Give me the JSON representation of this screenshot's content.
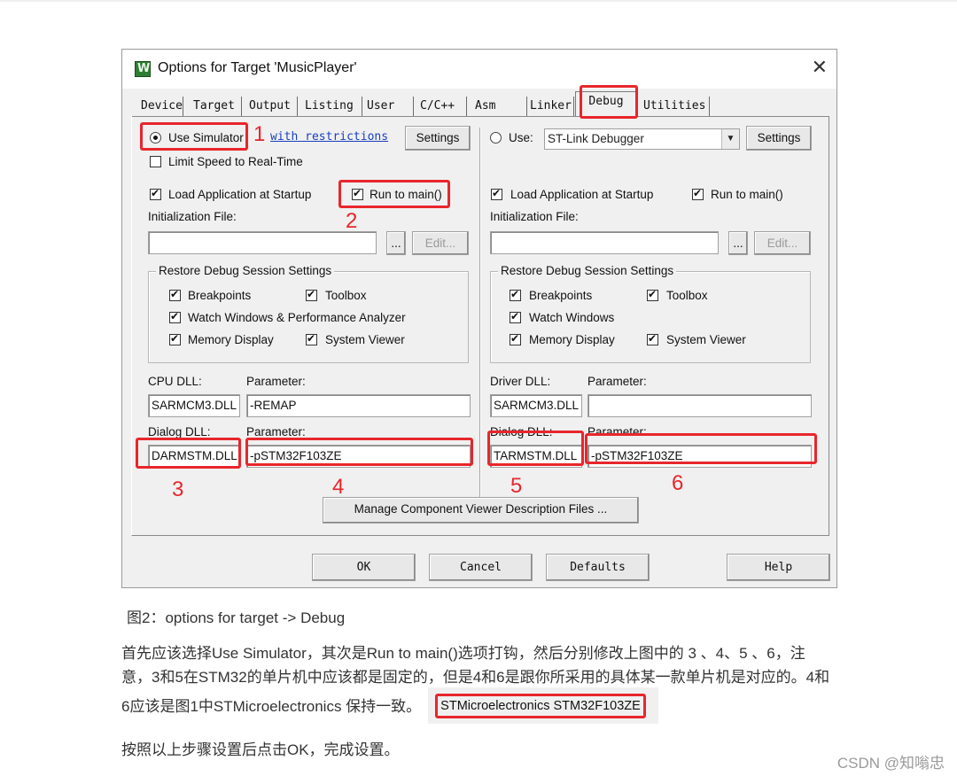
{
  "dialog": {
    "title": "Options for Target 'MusicPlayer'",
    "close_icon": "close-icon",
    "tabs": [
      "Device",
      "Target",
      "Output",
      "Listing",
      "User",
      "C/C++",
      "Asm",
      "Linker",
      "Debug",
      "Utilities"
    ],
    "active_tab": "Debug",
    "left": {
      "use_simulator": "Use Simulator",
      "with_restrictions": "with restrictions",
      "settings": "Settings",
      "limit_speed": "Limit Speed to Real-Time",
      "load_app": "Load Application at Startup",
      "run_to_main": "Run to main()",
      "init_file_label": "Initialization File:",
      "browse": "...",
      "edit": "Edit...",
      "restore_title": "Restore Debug Session Settings",
      "breakpoints": "Breakpoints",
      "toolbox": "Toolbox",
      "watch_windows": "Watch Windows & Performance Analyzer",
      "memory_display": "Memory Display",
      "system_viewer": "System Viewer",
      "cpu_dll_label": "CPU DLL:",
      "cpu_param_label": "Parameter:",
      "cpu_dll_value": "SARMCM3.DLL",
      "cpu_param_value": "-REMAP",
      "dialog_dll_label": "Dialog DLL:",
      "dialog_param_label": "Parameter:",
      "dialog_dll_value": "DARMSTM.DLL",
      "dialog_param_value": "-pSTM32F103ZE"
    },
    "right": {
      "use": "Use:",
      "debugger": "ST-Link Debugger",
      "settings": "Settings",
      "load_app": "Load Application at Startup",
      "run_to_main": "Run to main()",
      "init_file_label": "Initialization File:",
      "browse": "...",
      "edit": "Edit...",
      "restore_title": "Restore Debug Session Settings",
      "breakpoints": "Breakpoints",
      "toolbox": "Toolbox",
      "watch_windows": "Watch Windows",
      "memory_display": "Memory Display",
      "system_viewer": "System Viewer",
      "driver_dll_label": "Driver DLL:",
      "driver_param_label": "Parameter:",
      "driver_dll_value": "SARMCM3.DLL",
      "driver_param_value": "",
      "dialog_dll_label": "Dialog DLL:",
      "dialog_param_label": "Parameter:",
      "dialog_dll_value": "TARMSTM.DLL",
      "dialog_param_value": "-pSTM32F103ZE"
    },
    "manage_button": "Manage Component Viewer Description Files ...",
    "ok": "OK",
    "cancel": "Cancel",
    "defaults": "Defaults",
    "help": "Help"
  },
  "annotations": [
    "1",
    "2",
    "3",
    "4",
    "5",
    "6"
  ],
  "annotation_color": "#e8262c",
  "article": {
    "caption": "图2：options for target -> Debug",
    "paragraph": "首先应该选择Use Simulator，其次是Run to main()选项打钩，然后分别修改上图中的 3 、4、5 、6，注意，3和5在STM32的单片机中应该都是固定的，但是4和6是跟你所采用的具体某一款单片机是对应的。4和6应该是图1中STMicroelectronics 保持一致。",
    "inline_image_text": "STMicroelectronics STM32F103ZE",
    "after": "按照以上步骤设置后点击OK，完成设置。",
    "watermark": "CSDN @知嗡忠"
  }
}
